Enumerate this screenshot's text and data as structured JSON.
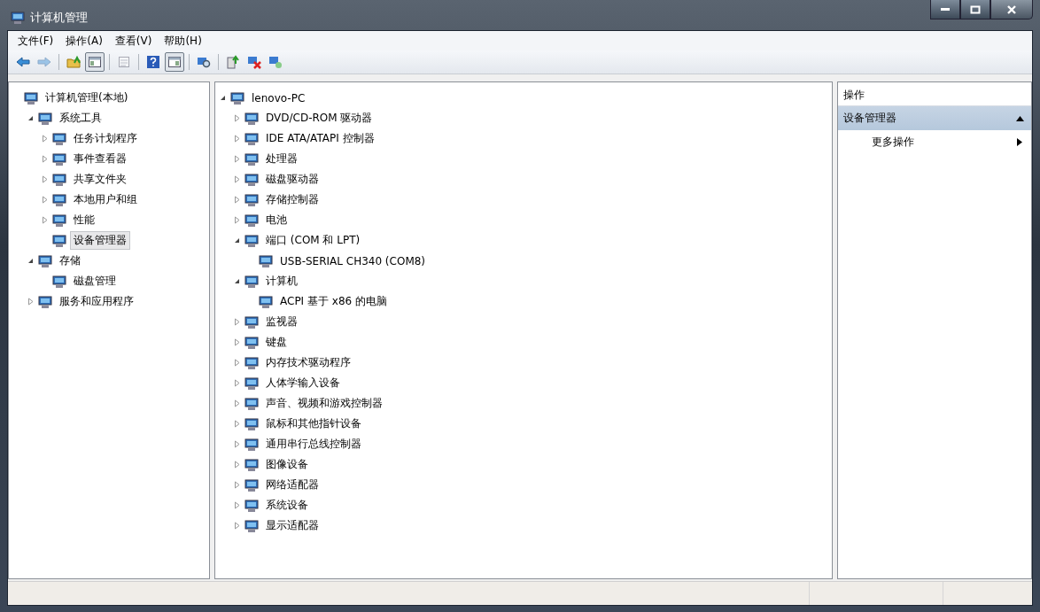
{
  "window": {
    "title": "计算机管理"
  },
  "menu": [
    {
      "label": "文件(F)"
    },
    {
      "label": "操作(A)"
    },
    {
      "label": "查看(V)"
    },
    {
      "label": "帮助(H)"
    }
  ],
  "toolbar": {
    "groups": [
      [
        {
          "pressed": false,
          "disabled": false
        },
        {
          "pressed": false,
          "disabled": true
        }
      ],
      [
        {
          "pressed": false,
          "disabled": false
        },
        {
          "pressed": true,
          "disabled": false
        }
      ],
      [
        {
          "pressed": false,
          "disabled": true
        }
      ],
      [
        {
          "pressed": false,
          "disabled": false
        },
        {
          "pressed": true,
          "disabled": false
        }
      ],
      [
        {
          "pressed": false,
          "disabled": false
        }
      ],
      [
        {
          "pressed": false,
          "disabled": false
        },
        {
          "pressed": false,
          "disabled": false
        },
        {
          "pressed": false,
          "disabled": false
        }
      ]
    ]
  },
  "console_tree": [
    {
      "label": "计算机管理(本地)",
      "selected": false,
      "children": [
        {
          "label": "系统工具",
          "expanded": true,
          "selected": false,
          "children": [
            {
              "label": "任务计划程序",
              "expanded": false,
              "selected": false
            },
            {
              "label": "事件查看器",
              "expanded": false,
              "selected": false
            },
            {
              "label": "共享文件夹",
              "expanded": false,
              "selected": false
            },
            {
              "label": "本地用户和组",
              "expanded": false,
              "selected": false
            },
            {
              "label": "性能",
              "expanded": false,
              "selected": false
            },
            {
              "label": "设备管理器",
              "selected": true
            }
          ]
        },
        {
          "label": "存储",
          "expanded": true,
          "selected": false,
          "children": [
            {
              "label": "磁盘管理",
              "selected": false
            }
          ]
        },
        {
          "label": "服务和应用程序",
          "expanded": false,
          "selected": false
        }
      ]
    }
  ],
  "device_tree": [
    {
      "label": "lenovo-PC",
      "expanded": true,
      "children": [
        {
          "label": "DVD/CD-ROM 驱动器",
          "expanded": false
        },
        {
          "label": "IDE ATA/ATAPI 控制器",
          "expanded": false
        },
        {
          "label": "处理器",
          "expanded": false
        },
        {
          "label": "磁盘驱动器",
          "expanded": false
        },
        {
          "label": "存储控制器",
          "expanded": false
        },
        {
          "label": "电池",
          "expanded": false
        },
        {
          "label": "端口 (COM 和 LPT)",
          "expanded": true,
          "children": [
            {
              "label": "USB-SERIAL CH340 (COM8)"
            }
          ]
        },
        {
          "label": "计算机",
          "expanded": true,
          "children": [
            {
              "label": "ACPI 基于 x86 的电脑"
            }
          ]
        },
        {
          "label": "监视器",
          "expanded": false
        },
        {
          "label": "键盘",
          "expanded": false
        },
        {
          "label": "内存技术驱动程序",
          "expanded": false
        },
        {
          "label": "人体学输入设备",
          "expanded": false
        },
        {
          "label": "声音、视频和游戏控制器",
          "expanded": false
        },
        {
          "label": "鼠标和其他指针设备",
          "expanded": false
        },
        {
          "label": "通用串行总线控制器",
          "expanded": false
        },
        {
          "label": "图像设备",
          "expanded": false
        },
        {
          "label": "网络适配器",
          "expanded": false
        },
        {
          "label": "系统设备",
          "expanded": false
        },
        {
          "label": "显示适配器",
          "expanded": false
        }
      ]
    }
  ],
  "actions": {
    "title": "操作",
    "sections": [
      {
        "title": "设备管理器",
        "expanded": true,
        "items": [
          {
            "label": "更多操作"
          }
        ]
      }
    ]
  }
}
